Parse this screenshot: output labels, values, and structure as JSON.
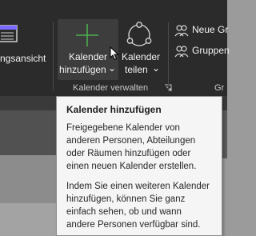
{
  "ribbon": {
    "left_partial_label": "ngsansicht",
    "add_calendar": {
      "line1": "Kalender",
      "line2": "hinzufügen",
      "caret": "⌄"
    },
    "share_calendar": {
      "line1": "Kalender",
      "line2": "teilen",
      "caret": "⌄"
    },
    "group_label": "Kalender verwalten",
    "right_items": [
      {
        "label": "Neue Gr"
      },
      {
        "label": "Gruppen"
      }
    ],
    "right_group_label_partial": "Gr"
  },
  "tooltip": {
    "title": "Kalender hinzufügen",
    "paragraph1": "Freigegebene Kalender von\nanderen Personen, Abteilungen\noder Räumen hinzufügen oder\neinen neuen Kalender erstellen.",
    "paragraph2": "Indem Sie einen weiteren Kalender\nhinzufügen, können Sie ganz\neinfach sehen, ob und wann\nandere Personen verfügbar sind."
  },
  "colors": {
    "ribbon_bg": "#2b2b2b",
    "accent_green": "#4caf50",
    "calendar_accent": "#7a6cff"
  }
}
